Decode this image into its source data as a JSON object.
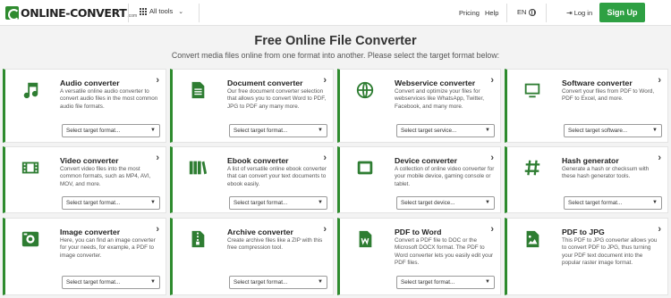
{
  "header": {
    "logo_text": "ONLINE-CONVERT",
    "logo_tld": ".com",
    "all_tools": "All tools",
    "pricing": "Pricing",
    "help": "Help",
    "lang": "EN",
    "login": "Log in",
    "signup": "Sign Up"
  },
  "main": {
    "title": "Free Online File Converter",
    "subtitle": "Convert media files online from one format into another. Please select the target format below:"
  },
  "cards": [
    {
      "title": "Audio converter",
      "desc": "A versatile online audio converter to convert audio files in the most common audio file formats.",
      "select": "Select target format...",
      "icon": "music-note-icon"
    },
    {
      "title": "Document converter",
      "desc": "Our free document converter selection that allows you to convert Word to PDF, JPG to PDF any many more.",
      "select": "Select target format...",
      "icon": "document-icon"
    },
    {
      "title": "Webservice converter",
      "desc": "Convert and optimize your files for webservices like WhatsApp, Twitter, Facebook, and many more.",
      "select": "Select target service...",
      "icon": "globe-icon"
    },
    {
      "title": "Software converter",
      "desc": "Convert your files from PDF to Word, PDF to Excel, and more.",
      "select": "Select target software...",
      "icon": "monitor-icon"
    },
    {
      "title": "Video converter",
      "desc": "Convert video files into the most common formats, such as MP4, AVI, MOV, and more.",
      "select": "Select target format...",
      "icon": "film-icon"
    },
    {
      "title": "Ebook converter",
      "desc": "A list of versatile online ebook converter that can convert your text documents to ebook easily.",
      "select": "Select target format...",
      "icon": "books-icon"
    },
    {
      "title": "Device converter",
      "desc": "A collection of online video converter for your mobile device, gaming console or tablet.",
      "select": "Select target device...",
      "icon": "tablet-icon"
    },
    {
      "title": "Hash generator",
      "desc": "Generate a hash or checksum with these hash generator tools.",
      "select": "Select target format...",
      "icon": "hash-icon"
    },
    {
      "title": "Image converter",
      "desc": "Here, you can find an image converter for your needs, for example, a PDF to image converter.",
      "select": "Select target format...",
      "icon": "image-icon"
    },
    {
      "title": "Archive converter",
      "desc": "Create archive files like a ZIP with this free compression tool.",
      "select": "Select target format...",
      "icon": "archive-icon"
    },
    {
      "title": "PDF to Word",
      "desc": "Convert a PDF file to DOC or the Microsoft DOCX format. The PDF to Word converter lets you easily edit your PDF files.",
      "select": "Select target format...",
      "icon": "word-file-icon"
    },
    {
      "title": "PDF to JPG",
      "desc": "This PDF to JPG converter allows you to convert PDF to JPG, thus turning your PDF text document into the popular raster image format.",
      "select": "Select target format...",
      "icon": "image-file-icon"
    }
  ],
  "colors": {
    "accent": "#2e8b2e",
    "signup": "#2ea043"
  }
}
